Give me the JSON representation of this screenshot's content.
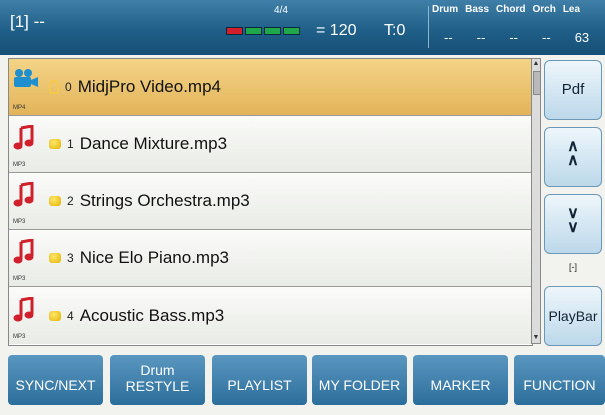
{
  "header": {
    "song": "[1] --",
    "dash": "-",
    "time_signature": "4/4",
    "tempo": "= 120",
    "transpose": "T:0",
    "tracks": [
      "Drum",
      "Bass",
      "Chord",
      "Orch",
      "Lea"
    ],
    "track_values": [
      "--",
      "--",
      "--",
      "--",
      "63"
    ]
  },
  "files": [
    {
      "index": "0",
      "name": "MidjPro Video.mp4",
      "type": "MP4",
      "icon": "video-camera-icon",
      "selected": true
    },
    {
      "index": "1",
      "name": "Dance Mixture.mp3",
      "type": "MP3",
      "icon": "music-note-icon",
      "selected": false
    },
    {
      "index": "2",
      "name": "Strings Orchestra.mp3",
      "type": "MP3",
      "icon": "music-note-icon",
      "selected": false
    },
    {
      "index": "3",
      "name": "Nice Elo Piano.mp3",
      "type": "MP3",
      "icon": "music-note-icon",
      "selected": false
    },
    {
      "index": "4",
      "name": "Acoustic Bass.mp3",
      "type": "MP3",
      "icon": "music-note-icon",
      "selected": false
    }
  ],
  "side": {
    "pdf": "Pdf",
    "page_up": "^\n^",
    "page_down": "v\nv",
    "page": "[-]",
    "playbar": "PlayBar"
  },
  "bottom": {
    "sync_next": "SYNC/NEXT",
    "drum_line1": "Drum",
    "drum_line2": "RESTYLE",
    "playlist": "PLAYLIST",
    "my_folder": "MY FOLDER",
    "marker": "MARKER",
    "function": "FUNCTION"
  },
  "colors": {
    "header": "#1f5f88",
    "selected_row": "#e2b45a",
    "button": "#2c6e9b"
  }
}
